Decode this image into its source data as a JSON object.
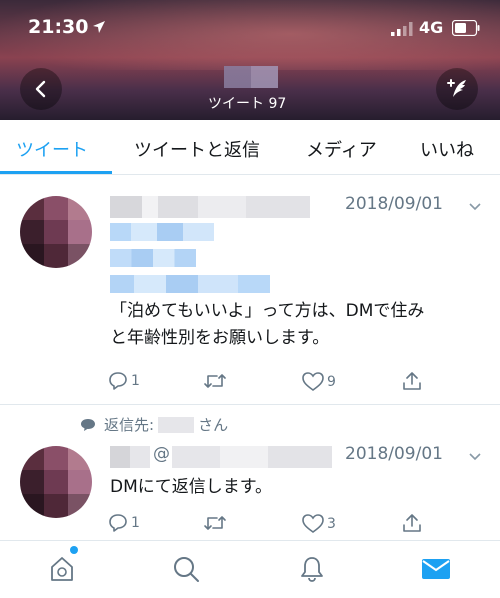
{
  "status_bar": {
    "time": "21:30",
    "network": "4G"
  },
  "header": {
    "tweet_count_label": "ツイート 97"
  },
  "tabs": [
    {
      "label": "ツイート",
      "active": true
    },
    {
      "label": "ツイートと返信",
      "active": false
    },
    {
      "label": "メディア",
      "active": false
    },
    {
      "label": "いいね",
      "active": false
    }
  ],
  "tweets": [
    {
      "date": "2018/09/01",
      "text_line1": "「泊めてもいいよ」って方は、DMで住み",
      "text_line2": "と年齢性別をお願いします。",
      "replies": "1",
      "retweets": "",
      "likes": "9"
    },
    {
      "reply_prefix": "返信先:",
      "reply_suffix": "さん",
      "handle_at": "@",
      "date": "2018/09/01",
      "text": "DMにて返信します。",
      "replies": "1",
      "retweets": "",
      "likes": "3"
    }
  ],
  "colors": {
    "accent": "#1da1f2",
    "muted": "#657786",
    "text": "#14171a",
    "divider": "#e1e8ed"
  },
  "icons": {
    "nav": [
      "home-icon",
      "search-icon",
      "bell-icon",
      "mail-icon"
    ],
    "actions": [
      "reply-icon",
      "retweet-icon",
      "heart-icon",
      "share-icon"
    ]
  }
}
